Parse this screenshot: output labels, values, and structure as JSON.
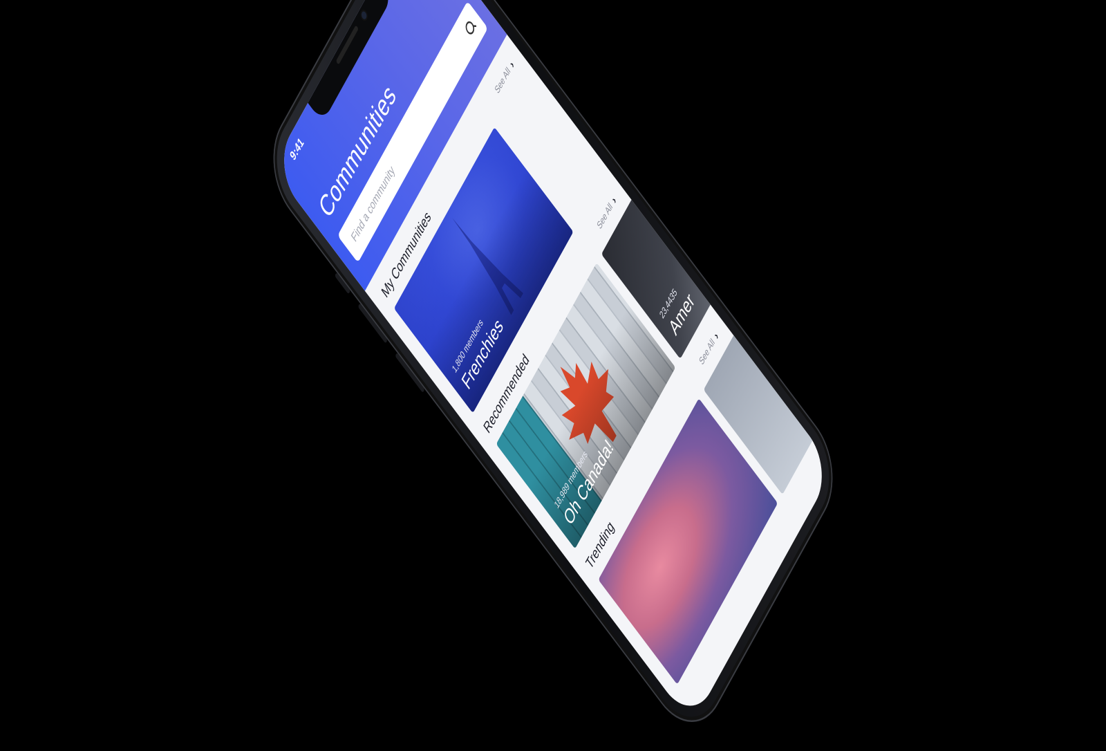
{
  "status_bar": {
    "time": "9:41"
  },
  "header": {
    "title": "Communities",
    "search_placeholder": "Find a community"
  },
  "sections": {
    "my_communities": {
      "title": "My Communities",
      "see_all": "See All",
      "cards": [
        {
          "name": "Frenchies",
          "members": "1,800 members"
        }
      ]
    },
    "recommended": {
      "title": "Recommended",
      "see_all": "See All",
      "cards": [
        {
          "name": "Oh Canada!",
          "members": "18,989 members"
        },
        {
          "name": "Amer",
          "members": "23,4435"
        }
      ]
    },
    "trending": {
      "title": "Trending",
      "see_all": "See All"
    }
  },
  "colors": {
    "header_start": "#3d5bf0",
    "header_end": "#6a6fe3",
    "background": "#f4f5f8"
  }
}
